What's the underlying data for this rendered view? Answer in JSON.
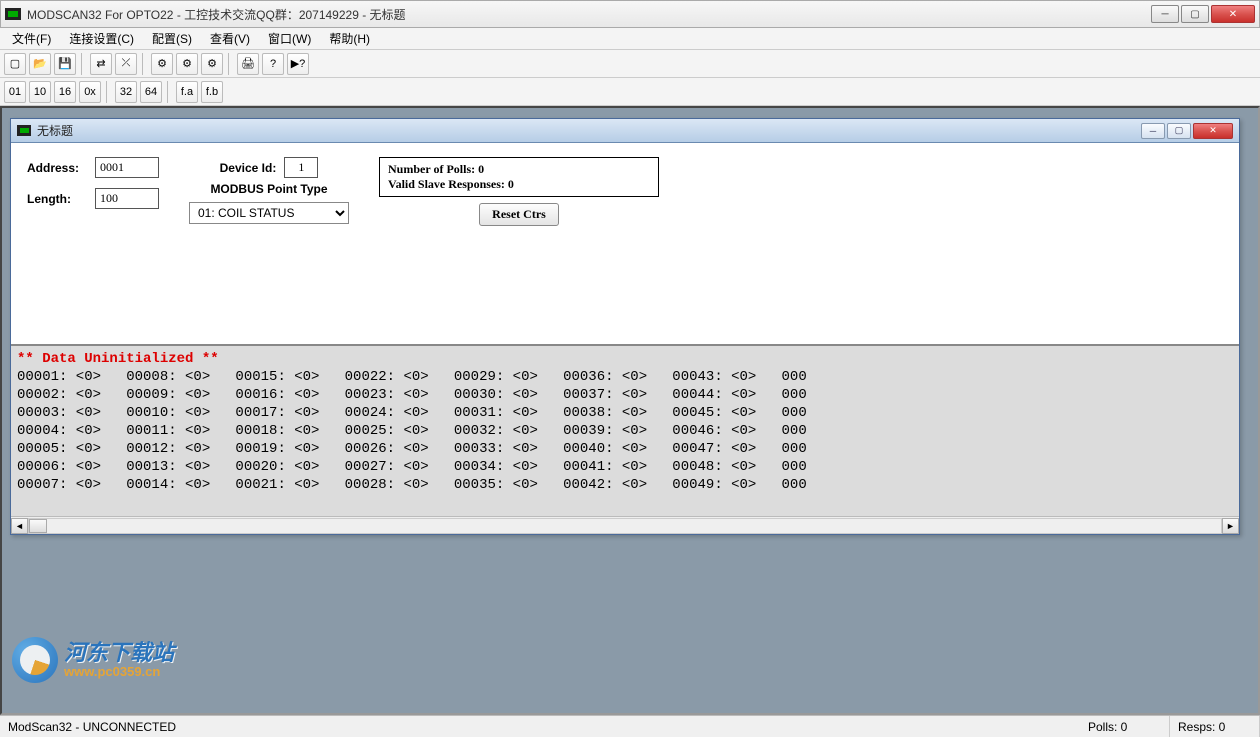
{
  "window_title": "MODSCAN32 For OPTO22 - 工控技术交流QQ群：207149229 - 无标题",
  "menu": [
    "文件(F)",
    "连接设置(C)",
    "配置(S)",
    "查看(V)",
    "窗口(W)",
    "帮助(H)"
  ],
  "toolbar1_icons": [
    "new",
    "open",
    "save",
    "|",
    "connect",
    "disconnect",
    "|",
    "cfg1",
    "cfg2",
    "cfg3",
    "|",
    "print",
    "help",
    "whatsthis"
  ],
  "toolbar2_icons": [
    "fmt-01",
    "fmt-10",
    "fmt-16",
    "fmt-0x",
    "|",
    "fmt-32",
    "fmt-64",
    "|",
    "fmt-fa",
    "fmt-fb"
  ],
  "child": {
    "title": "无标题",
    "address_label": "Address:",
    "address_value": "0001",
    "length_label": "Length:",
    "length_value": "100",
    "device_id_label": "Device Id:",
    "device_id_value": "1",
    "point_type_label": "MODBUS Point Type",
    "point_type_value": "01: COIL STATUS",
    "polls_label": "Number of Polls: 0",
    "valid_label": "Valid Slave Responses: 0",
    "reset_label": "Reset Ctrs",
    "data_header": "** Data Uninitialized **",
    "columns": 7,
    "rows": 7,
    "cell_value": "<0>",
    "extra_col_prefix": "000"
  },
  "status": {
    "main": "ModScan32 - UNCONNECTED",
    "polls": "Polls: 0",
    "resps": "Resps: 0"
  },
  "watermark": {
    "cn": "河东下载站",
    "url": "www.pc0359.cn"
  }
}
